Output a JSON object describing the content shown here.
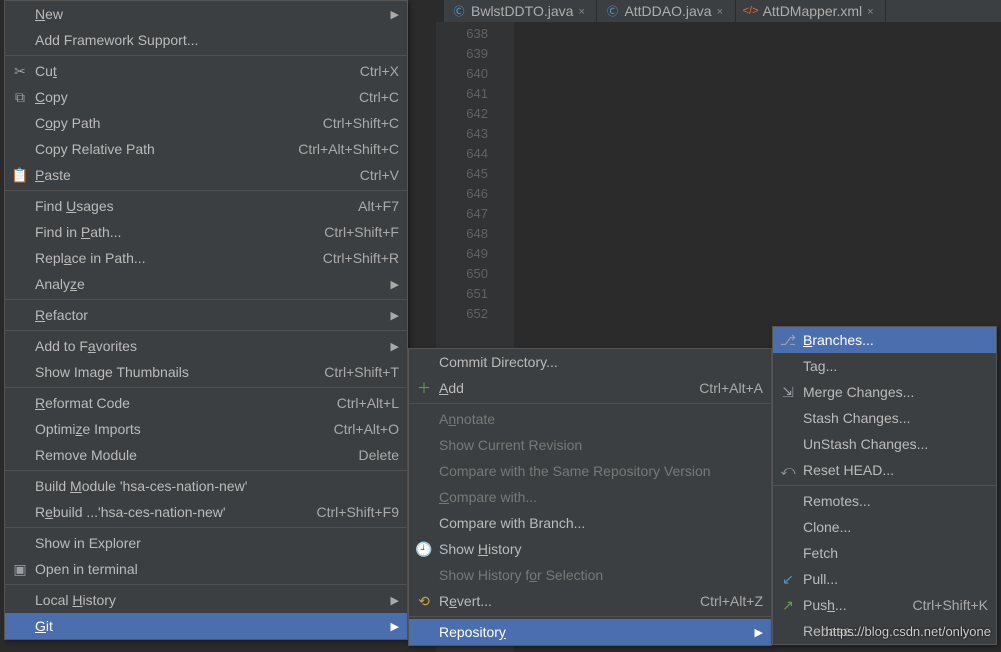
{
  "tabs": [
    {
      "icon": "class-icon",
      "iconColor": "#4aa3df",
      "label": "BwlstDDTO.java",
      "close": "×"
    },
    {
      "icon": "class-icon",
      "iconColor": "#4aa3df",
      "label": "AttDDAO.java",
      "close": "×"
    },
    {
      "icon": "xml-icon",
      "iconColor": "#e06c2b",
      "label": "AttDMapper.xml",
      "close": "×"
    }
  ],
  "line_numbers": [
    "638",
    "639",
    "640",
    "641",
    "642",
    "643",
    "644",
    "645",
    "646",
    "647",
    "648",
    "649",
    "650",
    "651",
    "652"
  ],
  "menu1": {
    "items": [
      {
        "label_html": "<span class='mn'>N</span>ew",
        "arrow": true
      },
      {
        "label_html": "Add Framework Support..."
      },
      {
        "sep": true
      },
      {
        "icon": "cut-icon",
        "iconGlyph": "✂",
        "label_html": "Cu<span class='mn'>t</span>",
        "shortcut": "Ctrl+X"
      },
      {
        "icon": "copy-icon",
        "iconGlyph": "⧉",
        "label_html": "<span class='mn'>C</span>opy",
        "shortcut": "Ctrl+C"
      },
      {
        "label_html": "C<span class='mn'>o</span>py Path",
        "shortcut": "Ctrl+Shift+C"
      },
      {
        "label_html": "Copy Relative Path",
        "shortcut": "Ctrl+Alt+Shift+C"
      },
      {
        "icon": "paste-icon",
        "iconGlyph": "📋",
        "label_html": "<span class='mn'>P</span>aste",
        "shortcut": "Ctrl+V"
      },
      {
        "sep": true
      },
      {
        "label_html": "Find <span class='mn'>U</span>sages",
        "shortcut": "Alt+F7"
      },
      {
        "label_html": "Find in <span class='mn'>P</span>ath...",
        "shortcut": "Ctrl+Shift+F"
      },
      {
        "label_html": "Repl<span class='mn'>a</span>ce in Path...",
        "shortcut": "Ctrl+Shift+R"
      },
      {
        "label_html": "Analy<span class='mn'>z</span>e",
        "arrow": true
      },
      {
        "sep": true
      },
      {
        "label_html": "<span class='mn'>R</span>efactor",
        "arrow": true
      },
      {
        "sep": true
      },
      {
        "label_html": "Add to F<span class='mn'>a</span>vorites",
        "arrow": true
      },
      {
        "label_html": "Show Image Thumbnails",
        "shortcut": "Ctrl+Shift+T"
      },
      {
        "sep": true
      },
      {
        "label_html": "<span class='mn'>R</span>eformat Code",
        "shortcut": "Ctrl+Alt+L"
      },
      {
        "label_html": "Optimi<span class='mn'>z</span>e Imports",
        "shortcut": "Ctrl+Alt+O"
      },
      {
        "label_html": "Remove Module",
        "shortcut": "Delete"
      },
      {
        "sep": true
      },
      {
        "label_html": "Build <span class='mn'>M</span>odule 'hsa-ces-nation-new'"
      },
      {
        "label_html": "R<span class='mn'>e</span>build ...'hsa-ces-nation-new'",
        "shortcut": "Ctrl+Shift+F9"
      },
      {
        "sep": true
      },
      {
        "label_html": "Show in Explorer"
      },
      {
        "icon": "terminal-icon",
        "iconGlyph": "▣",
        "label_html": "Open in terminal"
      },
      {
        "sep": true
      },
      {
        "label_html": "Local <span class='mn'>H</span>istory",
        "arrow": true
      },
      {
        "label_html": "<span class='mn'>G</span>it",
        "arrow": true,
        "hl": true
      }
    ]
  },
  "menu2": {
    "items": [
      {
        "label_html": "Commit Directory..."
      },
      {
        "icon": "add-icon",
        "iconGlyph": "＋",
        "iconColor": "#6a9e4e",
        "label_html": "<span class='mn'>A</span>dd",
        "shortcut": "Ctrl+Alt+A"
      },
      {
        "sep": true
      },
      {
        "label_html": "A<span class='mn'>n</span>notate",
        "disabled": true
      },
      {
        "label_html": "Show Current Revision",
        "disabled": true
      },
      {
        "label_html": "Compare with the Same Repository Version",
        "disabled": true
      },
      {
        "label_html": "<span class='mn'>C</span>ompare with...",
        "disabled": true
      },
      {
        "label_html": "Compare with Branch..."
      },
      {
        "icon": "history-icon",
        "iconGlyph": "🕘",
        "label_html": "Show <span class='mn'>H</span>istory"
      },
      {
        "label_html": "Show History f<span class='mn'>o</span>r Selection",
        "disabled": true
      },
      {
        "icon": "revert-icon",
        "iconGlyph": "⟲",
        "iconColor": "#c9a44a",
        "label_html": "R<span class='mn'>e</span>vert...",
        "shortcut": "Ctrl+Alt+Z"
      },
      {
        "sep": true
      },
      {
        "label_html": "Repositor<span class='mn'>y</span>",
        "arrow": true,
        "hl": true
      }
    ]
  },
  "menu3": {
    "items": [
      {
        "icon": "branches-icon",
        "iconGlyph": "⎇",
        "label_html": "<span class='mn'>B</span>ranches...",
        "hl": true
      },
      {
        "label_html": "Tag..."
      },
      {
        "icon": "merge-icon",
        "iconGlyph": "⇲",
        "label_html": "Merge Changes..."
      },
      {
        "label_html": "Stash Changes..."
      },
      {
        "label_html": "UnStash Changes..."
      },
      {
        "icon": "reset-icon",
        "iconGlyph": "⤺",
        "label_html": "Reset HEAD..."
      },
      {
        "sep": true
      },
      {
        "label_html": "Remotes..."
      },
      {
        "label_html": "Clone..."
      },
      {
        "label_html": "Fetch"
      },
      {
        "icon": "pull-icon",
        "iconGlyph": "↙",
        "iconColor": "#4e98c7",
        "label_html": "Pull..."
      },
      {
        "icon": "push-icon",
        "iconGlyph": "↗",
        "iconColor": "#6a9e4e",
        "label_html": "Pus<span class='mn'>h</span>...",
        "shortcut": "Ctrl+Shift+K"
      },
      {
        "label_html": "Rebase..."
      }
    ]
  },
  "watermark": "https://blog.csdn.net/onlyone"
}
